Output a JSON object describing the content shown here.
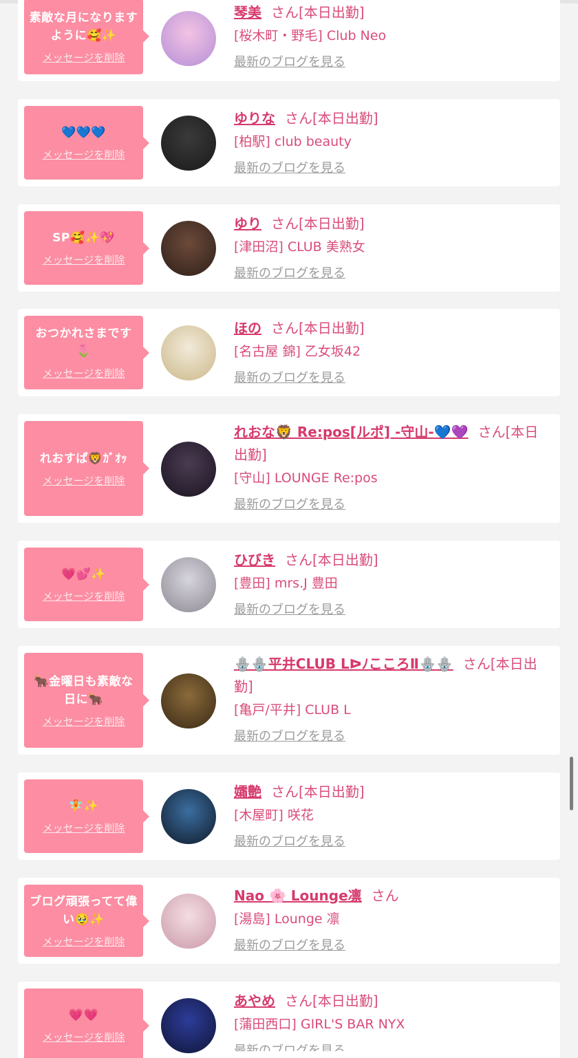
{
  "cards": [
    {
      "message": "素敵な月になりますように🥰✨",
      "delete_label": "メッセージを削除",
      "name": "琴美",
      "suffix": "さん[本日出勤]",
      "shop": "[桜木町・野毛] Club Neo",
      "blog_label": "最新のブログを見る",
      "avatar_colors": [
        "#f3c3e4",
        "#b48fd6"
      ]
    },
    {
      "message": "💙💙💙",
      "delete_label": "メッセージを削除",
      "name": "ゆりな",
      "suffix": "さん[本日出勤]",
      "shop": "[柏駅] club beauty",
      "blog_label": "最新のブログを見る",
      "avatar_colors": [
        "#3a3a3a",
        "#1a1a1a"
      ]
    },
    {
      "message": "SP🥰✨💖",
      "delete_label": "メッセージを削除",
      "name": "ゆり",
      "suffix": "さん[本日出勤]",
      "shop": "[津田沼] CLUB 美熟女",
      "blog_label": "最新のブログを見る",
      "avatar_colors": [
        "#6d4a3a",
        "#2e201a"
      ]
    },
    {
      "message": "おつかれさまです🌷",
      "delete_label": "メッセージを削除",
      "name": "ほの",
      "suffix": "さん[本日出勤]",
      "shop": "[名古屋 錦] 乙女坂42",
      "blog_label": "最新のブログを見る",
      "avatar_colors": [
        "#f2ead9",
        "#cbb98a"
      ]
    },
    {
      "message": "れおすぱ🦁ｶﾞｵｯ",
      "delete_label": "メッセージを削除",
      "name": "れおな🦁 Re:pos[ルポ] -守山-💙💜",
      "suffix": "さん[本日出勤]",
      "shop": "[守山] LOUNGE Re:pos",
      "blog_label": "最新のブログを見る",
      "avatar_colors": [
        "#4a3b52",
        "#1b1420"
      ]
    },
    {
      "message": "💗💕✨",
      "delete_label": "メッセージを削除",
      "name": "ひびき",
      "suffix": "さん[本日出勤]",
      "shop": "[豊田] mrs.J 豊田",
      "blog_label": "最新のブログを見る",
      "avatar_colors": [
        "#d6d4dc",
        "#8e8a94"
      ]
    },
    {
      "message": "🐂金曜日も素敵な日に🐂",
      "delete_label": "メッセージを削除",
      "name": "🪬🪬平井CLUB LᐅﾉこころⅡ🪬🪬",
      "suffix": "さん[本日出勤]",
      "shop": "[亀戸/平井] CLUB L",
      "blog_label": "最新のブログを見る",
      "avatar_colors": [
        "#8a6a3a",
        "#3a2a16"
      ]
    },
    {
      "message": "🧚✨",
      "delete_label": "メッセージを削除",
      "name": "孀艶",
      "suffix": "さん[本日出勤]",
      "shop": "[木屋町] 咲花",
      "blog_label": "最新のブログを見る",
      "avatar_colors": [
        "#3b6ea0",
        "#101a2a"
      ]
    },
    {
      "message": "ブログ頑張ってて偉い🥹✨",
      "delete_label": "メッセージを削除",
      "name": "Nao 🌸 Lounge凛",
      "suffix": "さん",
      "shop": "[湯島] Lounge 凛",
      "blog_label": "最新のブログを見る",
      "avatar_colors": [
        "#f4dde3",
        "#c99aa8"
      ]
    },
    {
      "message": "💗💗",
      "delete_label": "メッセージを削除",
      "name": "あやめ",
      "suffix": "さん[本日出勤]",
      "shop": "[蒲田西口] GIRL'S BAR NYX",
      "blog_label": "最新のブログを見る",
      "avatar_colors": [
        "#2d3c9a",
        "#101636"
      ]
    }
  ]
}
